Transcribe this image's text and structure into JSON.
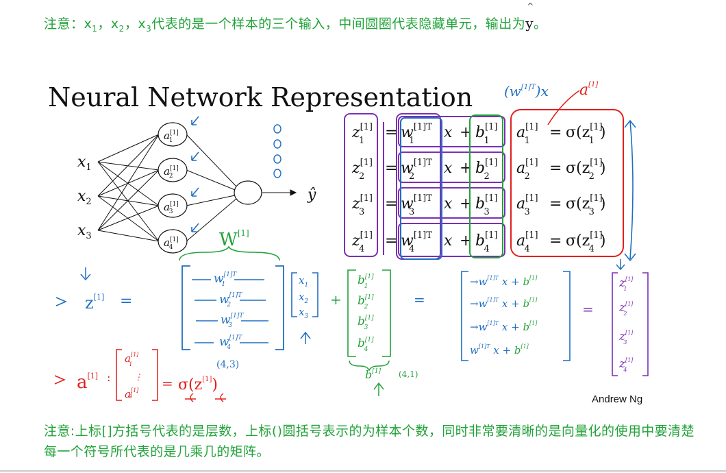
{
  "top_note": {
    "prefix": "注意：",
    "x_letter": "x",
    "sub1": "1",
    "sub2": "2",
    "sub3": "3",
    "comma": "，",
    "text": "代表的是一个样本的三个输入，中间圆圈代表隐藏单元，输出为",
    "y": "y",
    "hat": "^",
    "end": "。"
  },
  "slide": {
    "title": "Neural Network Representation",
    "credit": "Andrew Ng"
  },
  "network": {
    "inputs": [
      "x",
      "x",
      "x"
    ],
    "input_subs": [
      "1",
      "2",
      "3"
    ],
    "hidden_letter": "a",
    "hidden_sup": "[1]",
    "hidden_subs": [
      "1",
      "2",
      "3",
      "4"
    ],
    "output": "ŷ"
  },
  "equations": {
    "z": "z",
    "w": "w",
    "b": "b",
    "a": "a",
    "sup": "[1]",
    "sup_t": "[1]T",
    "eq": "=",
    "x": "x",
    "plus": "+",
    "sigma": "σ(z",
    "close": ")",
    "rows": [
      "1",
      "2",
      "3",
      "4"
    ]
  },
  "handwriting": {
    "w_label": "W",
    "w_sup": "[1]",
    "z_vec_label": "z",
    "z_vec_sup": "[1]",
    "eq": "=",
    "w_dims": "(4,3)",
    "b_dims": "(4,1)",
    "b_label": "b",
    "b_sup": "[1]",
    "a_label": "a",
    "a_sup": "[1]",
    "sigma_expr": "σ(z",
    "annotation": "(w",
    "annotation_sup": "[1]T",
    "annotation_x": ")x",
    "annotation_a": "a",
    "annotation_a_sup": "[1]"
  },
  "bottom_note": "注意:上标[]方括号代表的是层数，上标()圆括号表示的为样本个数，同时非常要清晰的是向量化的使用中要清楚每一个符号所代表的是几乘几的矩阵。",
  "colors": {
    "note_green": "#22a33a",
    "purple": "#7b2fb5",
    "blue": "#1f6fc0",
    "green": "#23a23a",
    "red": "#e0201d"
  }
}
